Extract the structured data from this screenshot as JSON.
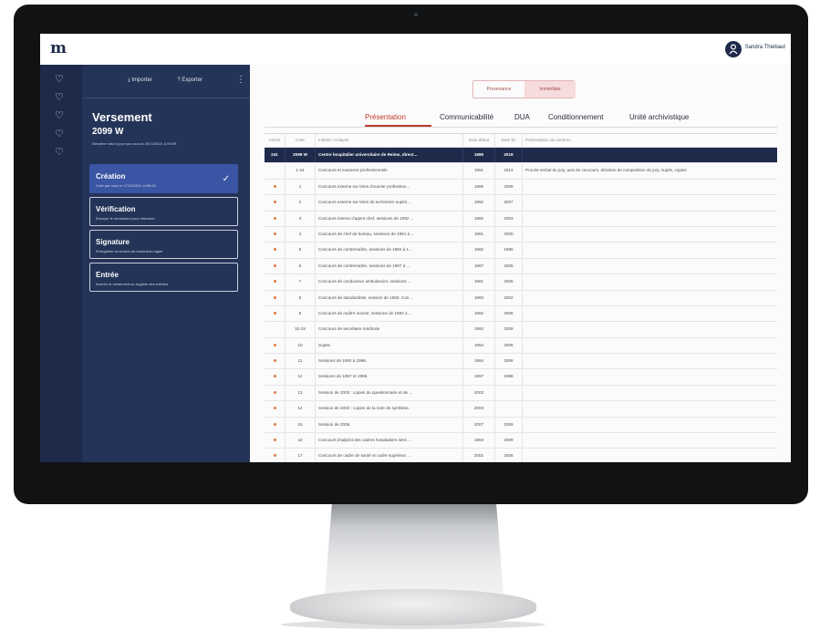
{
  "app": {
    "logo": "m",
    "user_name": "Sandra Thiebaut"
  },
  "toolbar": {
    "import_label": "Importer",
    "export_label": "Exporter",
    "menu_glyph": "⋮"
  },
  "versement": {
    "title": "Versement",
    "code": "2099 W",
    "last_update": "Dernière mise à jour par vous le 20/12/2021 à 09:09"
  },
  "steps": [
    {
      "title": "Création",
      "desc": "Créé par vous le 17/12/2021 à 09h31",
      "active": true
    },
    {
      "title": "Vérification",
      "desc": "Envoyer le versement pour relecture",
      "active": false
    },
    {
      "title": "Signature",
      "desc": "Enregistrer la version du bordereau signé",
      "active": false
    },
    {
      "title": "Entrée",
      "desc": "Inscrire le versement au registre des entrées",
      "active": false
    }
  ],
  "segmented": {
    "left": "Provenance",
    "right": "Immédiate"
  },
  "tabs": [
    "Présentation",
    "Communicabilité",
    "DUA",
    "Conditionnement",
    "Unité archivistique"
  ],
  "table": {
    "headers": {
      "article": "Article",
      "cote": "Cote",
      "intitule": "Intitulé / Analyse",
      "date_debut": "Date début",
      "date_fin": "Date fin",
      "presentation": "Présentation du contenu"
    },
    "rows": [
      {
        "article": "241",
        "cote": "2099 W",
        "intitule": "Centre hospitalier universitaire de Reims, direct...",
        "dd": "1989",
        "df": "2019",
        "pres": ""
      },
      {
        "article": "",
        "cote": "1-24",
        "intitule": "Concours et examens professionnels",
        "dd": "1991",
        "df": "2013",
        "pres": "Procès-verbal du jury, avis de concours, décision de composition du jury, sujets, copies"
      },
      {
        "article": "•",
        "cote": "1",
        "intitule": "Concours externe sur titres d'ouvrier profession...",
        "dd": "1996",
        "df": "2008",
        "pres": ""
      },
      {
        "article": "•",
        "cote": "2",
        "intitule": "Concours externe sur titres de technicien supéri...",
        "dd": "1992",
        "df": "2007",
        "pres": ""
      },
      {
        "article": "•",
        "cote": "3",
        "intitule": "Concours interne d'agent chef, sessions de 1992 ...",
        "dd": "1992",
        "df": "2003",
        "pres": ""
      },
      {
        "article": "•",
        "cote": "4",
        "intitule": "Concours de chef de bureau, sessions de 1991 à ...",
        "dd": "1991",
        "df": "2000",
        "pres": ""
      },
      {
        "article": "•",
        "cote": "5",
        "intitule": "Concours de contremaître, sessions de 1992 à 1...",
        "dd": "1992",
        "df": "1996",
        "pres": ""
      },
      {
        "article": "•",
        "cote": "6",
        "intitule": "Concours de contremaître, sessions de 1997 à ...",
        "dd": "1997",
        "df": "2006",
        "pres": ""
      },
      {
        "article": "•",
        "cote": "7",
        "intitule": "Concours de conducteur ambulancier, sessions ...",
        "dd": "1991",
        "df": "2005",
        "pres": ""
      },
      {
        "article": "•",
        "cote": "8",
        "intitule": "Concours de standardiste, session de 1993. Con...",
        "dd": "1993",
        "df": "2002",
        "pres": ""
      },
      {
        "article": "•",
        "cote": "9",
        "intitule": "Concours de maître ouvrier, sessions de 1992 à ...",
        "dd": "1992",
        "df": "2006",
        "pres": ""
      },
      {
        "article": "",
        "cote": "10-15",
        "intitule": "Concours de secrétaire médicale",
        "dd": "1992",
        "df": "2009",
        "pres": ""
      },
      {
        "article": "•",
        "cote": "10",
        "intitule": "Sujets.",
        "dd": "1994",
        "df": "2006",
        "pres": ""
      },
      {
        "article": "•",
        "cote": "11",
        "intitule": "Sessions de 1992 à 1996.",
        "dd": "1994",
        "df": "2006",
        "pres": ""
      },
      {
        "article": "•",
        "cote": "12",
        "intitule": "Sessions de 1997 et 1998.",
        "dd": "1997",
        "df": "1998",
        "pres": ""
      },
      {
        "article": "•",
        "cote": "13",
        "intitule": "Session de 2003 : copies du questionnaire et de ...",
        "dd": "2003",
        "df": "",
        "pres": ""
      },
      {
        "article": "•",
        "cote": "14",
        "intitule": "Session de 2003 : copies de la note de synthèse.",
        "dd": "2003",
        "df": "",
        "pres": ""
      },
      {
        "article": "•",
        "cote": "15",
        "intitule": "Session de 2006.",
        "dd": "2007",
        "df": "2009",
        "pres": ""
      },
      {
        "article": "•",
        "cote": "16",
        "intitule": "Concours d'adjoint des cadres hospitaliers sess ...",
        "dd": "1993",
        "df": "2009",
        "pres": ""
      },
      {
        "article": "•",
        "cote": "17",
        "intitule": "Concours de cadre de santé et cadre supérieur ...",
        "dd": "2002",
        "df": "2006",
        "pres": ""
      }
    ]
  }
}
